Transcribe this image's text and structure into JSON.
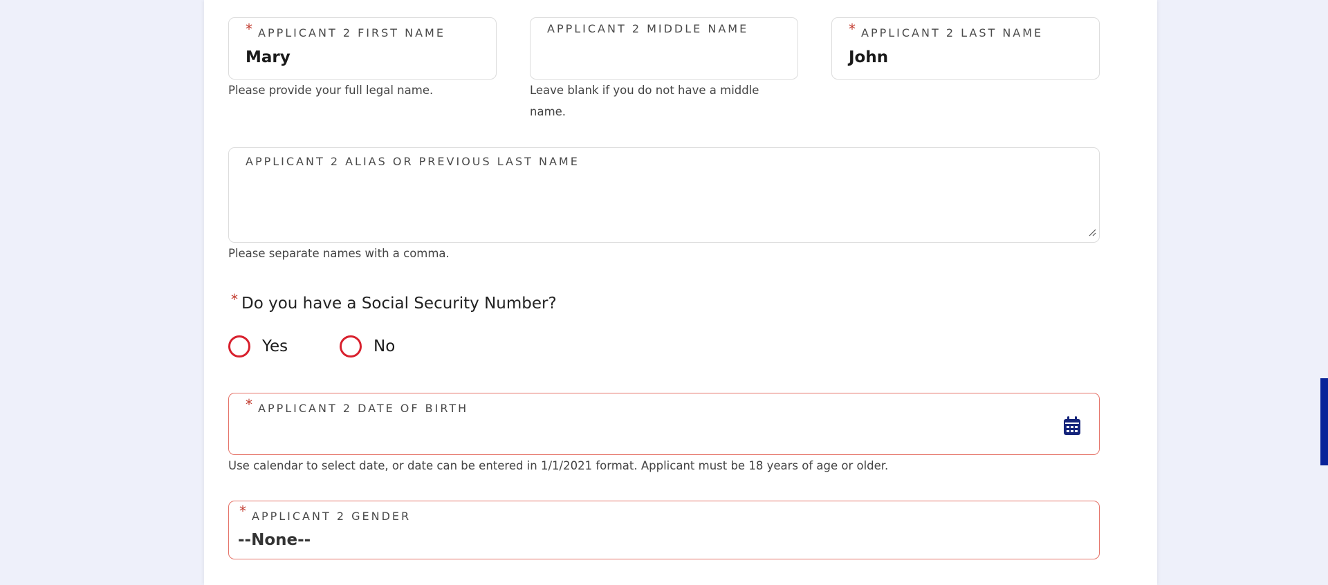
{
  "applicant": {
    "first_name": {
      "label": "APPLICANT 2 FIRST NAME",
      "required_mark": "*",
      "value": "Mary",
      "help": "Please provide your full legal name."
    },
    "middle_name": {
      "label": "APPLICANT 2 MIDDLE NAME",
      "value": "",
      "help_line1": "Leave blank if you do not have a middle",
      "help_line2": "name."
    },
    "last_name": {
      "label": "APPLICANT 2 LAST NAME",
      "required_mark": "*",
      "value": "John"
    },
    "alias": {
      "label": "APPLICANT 2 ALIAS OR PREVIOUS LAST NAME",
      "value": "",
      "help": "Please separate names with a comma."
    },
    "ssn_question": {
      "required_mark": "*",
      "text": "Do you have a Social Security Number?",
      "options": [
        {
          "label": "Yes"
        },
        {
          "label": "No"
        }
      ]
    },
    "dob": {
      "label": "APPLICANT 2 DATE OF BIRTH",
      "required_mark": "*",
      "value": "",
      "icon": "calendar-icon",
      "help": "Use calendar to select date, or date can be entered in 1/1/2021 format. Applicant must be 18 years of age or older."
    },
    "gender": {
      "label": "APPLICANT 2 GENDER",
      "required_mark": "*",
      "selected": "--None--"
    }
  },
  "colors": {
    "required": "#c23b2f",
    "error_border": "#e57368",
    "radio_border": "#d8202d",
    "accent": "#0a2399",
    "page_bg": "#eef0fa"
  }
}
